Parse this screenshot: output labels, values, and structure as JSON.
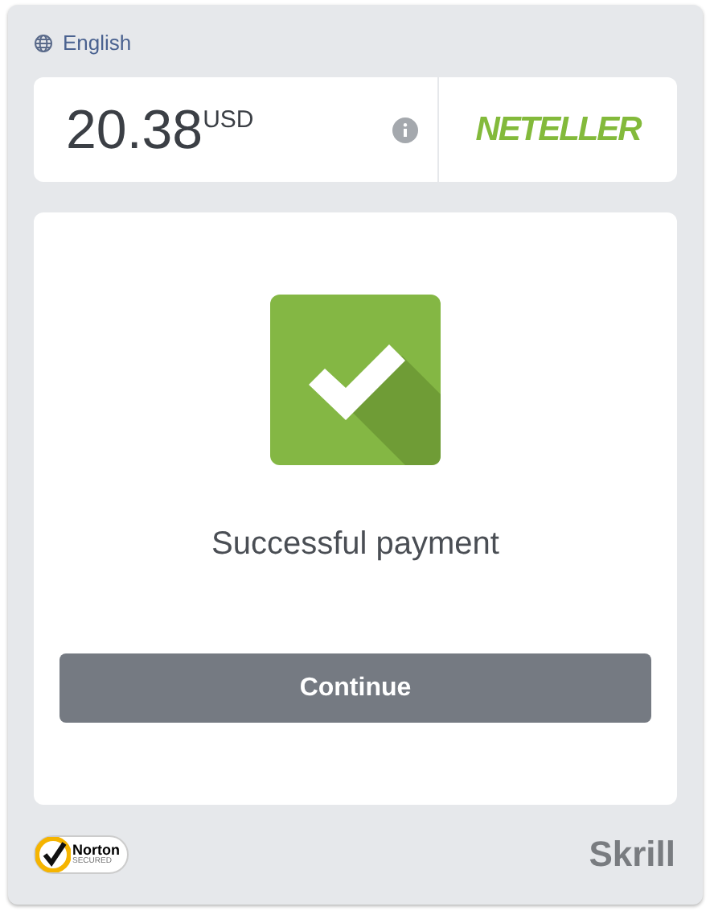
{
  "language": "English",
  "amount": {
    "value": "20.38",
    "currency": "USD"
  },
  "provider_logo": "NETELLER",
  "status": {
    "message": "Successful payment"
  },
  "button": "Continue",
  "footer": {
    "norton_top": "Norton",
    "norton_bottom": "SECURED",
    "brand": "Skrill"
  }
}
